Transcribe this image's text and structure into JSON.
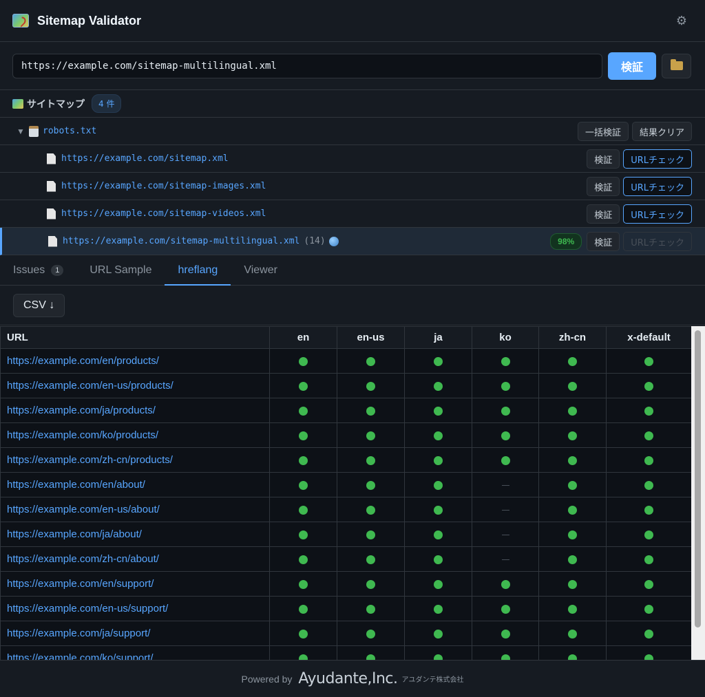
{
  "app": {
    "title": "Sitemap Validator"
  },
  "urlbar": {
    "value": "https://example.com/sitemap-multilingual.xml",
    "verify_label": "検証"
  },
  "section": {
    "title": "サイトマップ",
    "count": "4 件"
  },
  "tree": {
    "root": {
      "label": "robots.txt",
      "bulk_verify_label": "一括検証",
      "clear_label": "結果クリア"
    },
    "items": [
      {
        "url": "https://example.com/sitemap.xml",
        "verify_label": "検証",
        "urlcheck_label": "URLチェック"
      },
      {
        "url": "https://example.com/sitemap-images.xml",
        "verify_label": "検証",
        "urlcheck_label": "URLチェック"
      },
      {
        "url": "https://example.com/sitemap-videos.xml",
        "verify_label": "検証",
        "urlcheck_label": "URLチェック"
      },
      {
        "url": "https://example.com/sitemap-multilingual.xml",
        "count": "(14)",
        "percent": "98%",
        "verify_label": "検証",
        "urlcheck_label": "URLチェック"
      }
    ]
  },
  "tabs": [
    {
      "label": "Issues",
      "badge": "1"
    },
    {
      "label": "URL Sample"
    },
    {
      "label": "hreflang"
    },
    {
      "label": "Viewer"
    }
  ],
  "csv_label": "CSV ↓",
  "table": {
    "headers": [
      "URL",
      "en",
      "en-us",
      "ja",
      "ko",
      "zh-cn",
      "x-default"
    ],
    "rows": [
      {
        "url": "https://example.com/en/products/",
        "cells": [
          1,
          1,
          1,
          1,
          1,
          1
        ]
      },
      {
        "url": "https://example.com/en-us/products/",
        "cells": [
          1,
          1,
          1,
          1,
          1,
          1
        ]
      },
      {
        "url": "https://example.com/ja/products/",
        "cells": [
          1,
          1,
          1,
          1,
          1,
          1
        ]
      },
      {
        "url": "https://example.com/ko/products/",
        "cells": [
          1,
          1,
          1,
          1,
          1,
          1
        ]
      },
      {
        "url": "https://example.com/zh-cn/products/",
        "cells": [
          1,
          1,
          1,
          1,
          1,
          1
        ]
      },
      {
        "url": "https://example.com/en/about/",
        "cells": [
          1,
          1,
          1,
          0,
          1,
          1
        ]
      },
      {
        "url": "https://example.com/en-us/about/",
        "cells": [
          1,
          1,
          1,
          0,
          1,
          1
        ]
      },
      {
        "url": "https://example.com/ja/about/",
        "cells": [
          1,
          1,
          1,
          0,
          1,
          1
        ]
      },
      {
        "url": "https://example.com/zh-cn/about/",
        "cells": [
          1,
          1,
          1,
          0,
          1,
          1
        ]
      },
      {
        "url": "https://example.com/en/support/",
        "cells": [
          1,
          1,
          1,
          1,
          1,
          1
        ]
      },
      {
        "url": "https://example.com/en-us/support/",
        "cells": [
          1,
          1,
          1,
          1,
          1,
          1
        ]
      },
      {
        "url": "https://example.com/ja/support/",
        "cells": [
          1,
          1,
          1,
          1,
          1,
          1
        ]
      },
      {
        "url": "https://example.com/ko/support/",
        "cells": [
          1,
          1,
          1,
          1,
          1,
          1
        ]
      }
    ]
  },
  "footer": {
    "powered_by": "Powered by",
    "company": "Ayudante,Inc.",
    "company_jp": "アユダンテ株式会社"
  }
}
